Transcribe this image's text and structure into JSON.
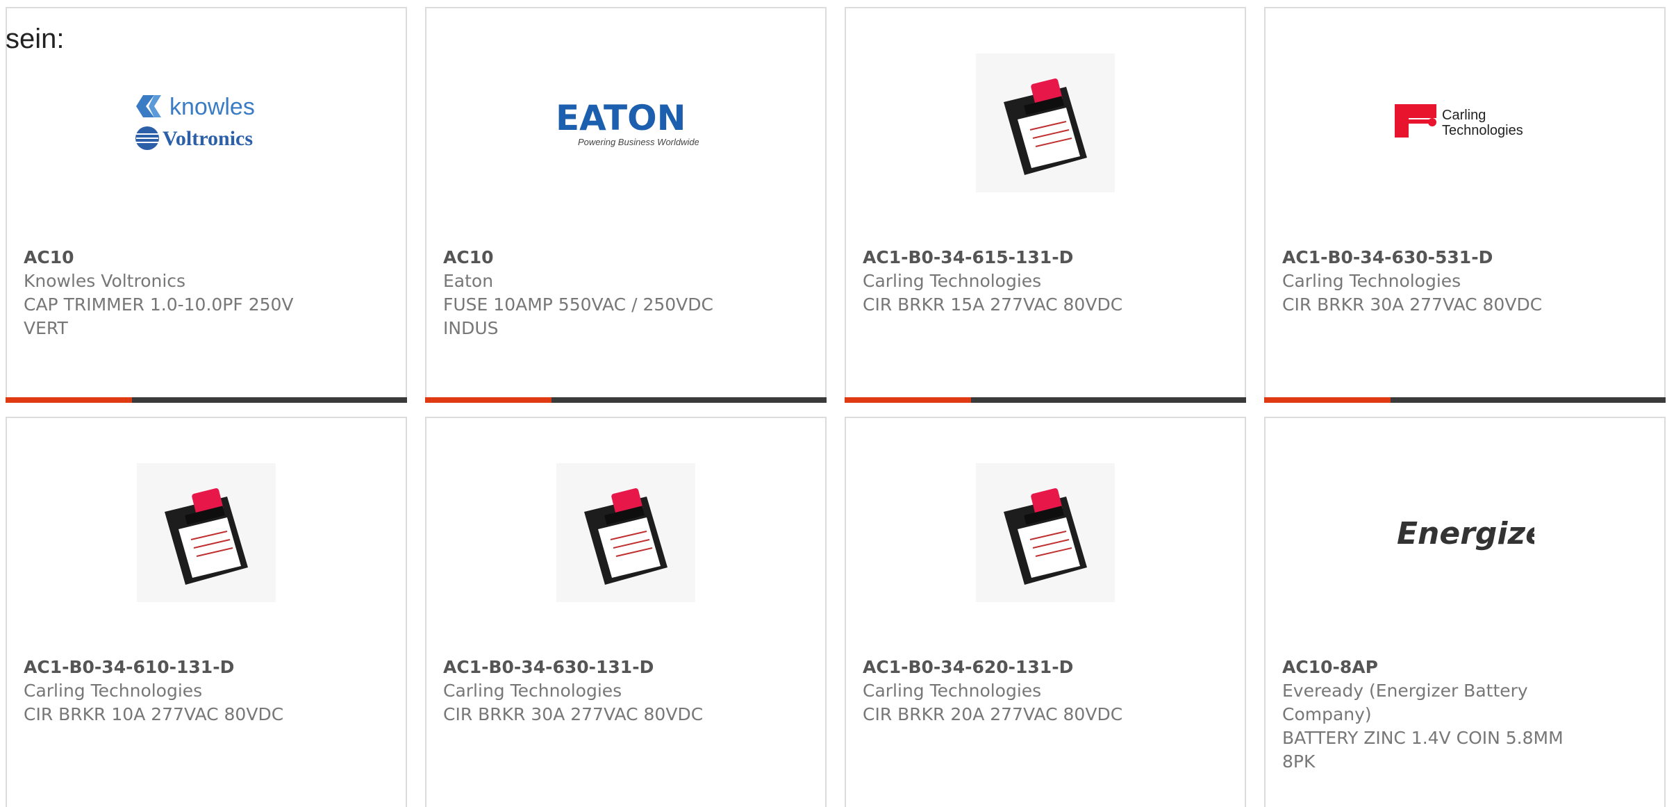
{
  "intro": {
    "text": "sein:"
  },
  "colors": {
    "accent": "#e03a12",
    "bar_dark": "#3b3b3b",
    "card_border": "#dcdcdc",
    "text_muted": "#777777"
  },
  "products": [
    {
      "part_number": "AC10",
      "manufacturer": "Knowles Voltronics",
      "description": "CAP TRIMMER 1.0-10.0PF 250V VERT",
      "image": "knowles-voltronics-logo",
      "logo_text": {
        "line1": "knowles",
        "line2": "Voltronics"
      }
    },
    {
      "part_number": "AC10",
      "manufacturer": "Eaton",
      "description": "FUSE 10AMP 550VAC / 250VDC INDUS",
      "image": "eaton-logo",
      "logo_text": {
        "line1": "EATON",
        "line2": "Powering Business Worldwide"
      }
    },
    {
      "part_number": "AC1-B0-34-615-131-D",
      "manufacturer": "Carling Technologies",
      "description": "CIR BRKR 15A 277VAC 80VDC",
      "image": "circuit-breaker-photo"
    },
    {
      "part_number": "AC1-B0-34-630-531-D",
      "manufacturer": "Carling Technologies",
      "description": "CIR BRKR 30A 277VAC 80VDC",
      "image": "carling-technologies-logo",
      "logo_text": {
        "line1": "Carling",
        "line2": "Technologies"
      }
    },
    {
      "part_number": "AC1-B0-34-610-131-D",
      "manufacturer": "Carling Technologies",
      "description": "CIR BRKR 10A 277VAC 80VDC",
      "image": "circuit-breaker-photo"
    },
    {
      "part_number": "AC1-B0-34-630-131-D",
      "manufacturer": "Carling Technologies",
      "description": "CIR BRKR 30A 277VAC 80VDC",
      "image": "circuit-breaker-photo"
    },
    {
      "part_number": "AC1-B0-34-620-131-D",
      "manufacturer": "Carling Technologies",
      "description": "CIR BRKR 20A 277VAC 80VDC",
      "image": "circuit-breaker-photo"
    },
    {
      "part_number": "AC10-8AP",
      "manufacturer": "Eveready (Energizer Battery Company)",
      "description": "BATTERY ZINC 1.4V COIN 5.8MM 8PK",
      "image": "energizer-logo",
      "logo_text": {
        "line1": "Energizer"
      }
    }
  ]
}
